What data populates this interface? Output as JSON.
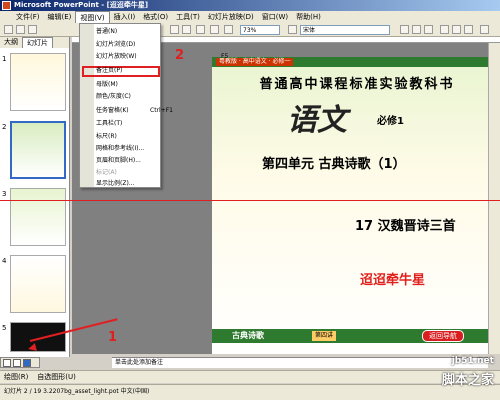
{
  "window": {
    "title": "Microsoft PowerPoint - [迢迢牵牛星]"
  },
  "menubar": {
    "items": [
      "文件(F)",
      "编辑(E)",
      "视图(V)",
      "插入(I)",
      "格式(O)",
      "工具(T)",
      "幻灯片放映(D)",
      "窗口(W)",
      "帮助(H)"
    ]
  },
  "toolbar": {
    "zoom": "73%",
    "font": "宋体"
  },
  "pane": {
    "tabs": [
      "大纲",
      "幻灯片"
    ],
    "thumb_numbers": [
      "1",
      "2",
      "3",
      "4",
      "5"
    ]
  },
  "view_menu": {
    "items": [
      {
        "label": "普通(N)"
      },
      {
        "label": "幻灯片浏览(D)"
      },
      {
        "label": "幻灯片放映(W)",
        "key": "F5"
      },
      {
        "label": "备注页(P)"
      },
      {
        "label": "母版(M)"
      },
      {
        "label": "颜色/灰度(C)"
      },
      {
        "label": "任务窗格(K)",
        "key": "Ctrl+F1"
      },
      {
        "label": "工具栏(T)"
      },
      {
        "label": "标尺(R)"
      },
      {
        "label": "网格和参考线(I)..."
      },
      {
        "label": "页眉和页脚(H)..."
      },
      {
        "label": "标记(A)"
      },
      {
        "label": "显示比例(Z)..."
      }
    ]
  },
  "slide": {
    "badge": "粤教版 · 高中语文 · 必修一",
    "title1": "普通高中课程标准实验教科书",
    "yuwen": "语文",
    "bixiu": "必修1",
    "unit": "第四单元  古典诗歌（1）",
    "lesson": "17 汉魏晋诗三首",
    "poem": "迢迢牵牛星",
    "footer_left": "古典诗歌",
    "footer_btn": "第四讲",
    "footer_btn2": "返回导航"
  },
  "annotations": {
    "num1": "1",
    "num2": "2"
  },
  "notes": {
    "placeholder": "单击此处添加备注"
  },
  "drawbar": {
    "draw": "绘图(R)",
    "autoshapes": "自选图形(U)"
  },
  "statusbar": {
    "text": "幻灯片 2 / 19    3.2207bg_asset_light.pot    中文(中国)"
  },
  "watermark": {
    "line1": "jb51.net",
    "line2": "脚本之家"
  }
}
